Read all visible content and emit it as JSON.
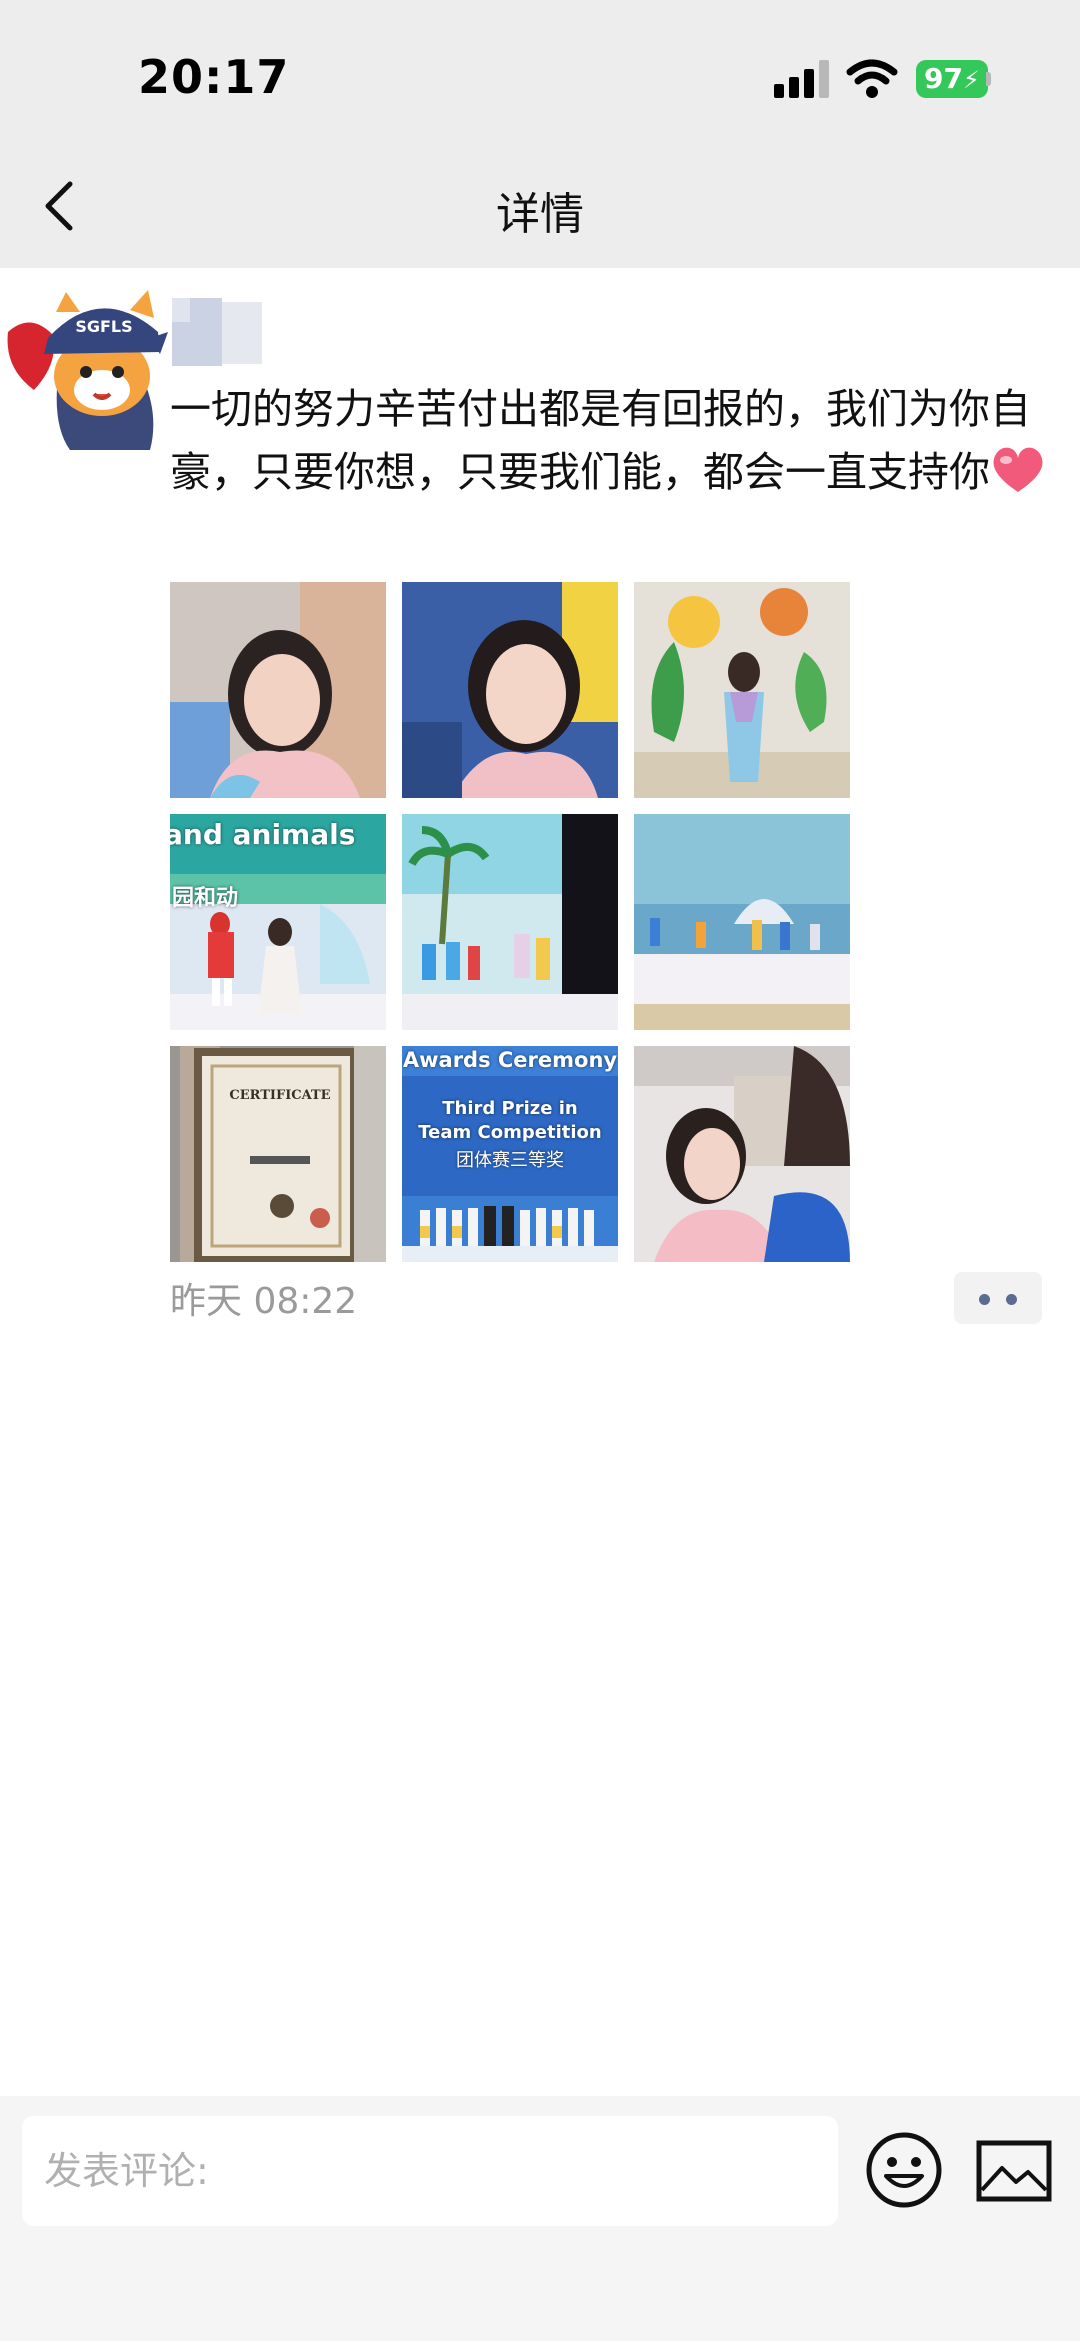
{
  "status_bar": {
    "time": "20:17",
    "battery": "97"
  },
  "nav": {
    "title": "详情"
  },
  "post": {
    "text": "一切的努力辛苦付出都是有回报的，我们为你自豪，只要你想，只要我们能，都会一直支持你",
    "avatar_badge": "SGFLS",
    "timestamp": "昨天 08:22",
    "photos": [
      {
        "caption": ""
      },
      {
        "caption": ""
      },
      {
        "caption": ""
      },
      {
        "caption": "and animals",
        "caption2": "园和动"
      },
      {
        "caption": ""
      },
      {
        "caption": ""
      },
      {
        "caption": "CERTIFICATE"
      },
      {
        "caption": "Awards Ceremony",
        "caption2": "Third Prize in",
        "caption3": "Team Competition",
        "caption4": "团体赛三等奖"
      },
      {
        "caption": ""
      }
    ]
  },
  "comment_bar": {
    "placeholder": "发表评论:"
  },
  "colors": {
    "header_bg": "#ededed",
    "accent_link": "#5a6c8f",
    "battery_green": "#34c759"
  }
}
